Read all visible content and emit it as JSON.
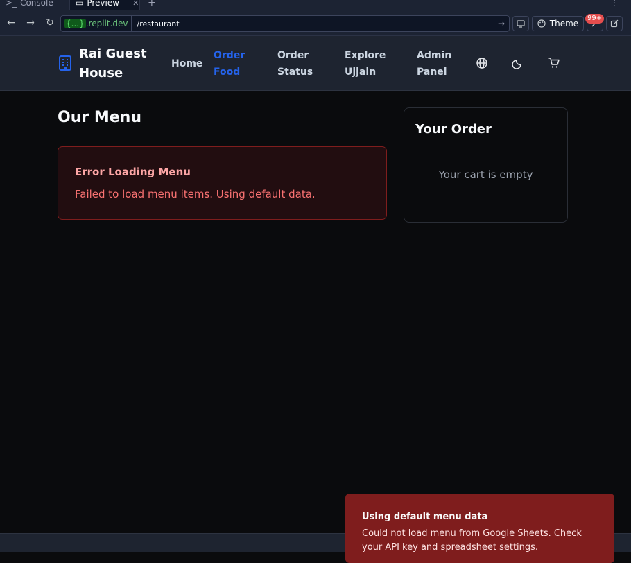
{
  "ide_tabs": {
    "console": "Console",
    "preview": "Preview"
  },
  "browser": {
    "domain_highlight": "{...}",
    "domain_rest": ".replit.dev",
    "path": "/restaurant",
    "theme_label": "Theme",
    "badge": "99+"
  },
  "site": {
    "brand": "Rai Guest House",
    "nav": [
      "Home",
      "Order Food",
      "Order Status",
      "Explore Ujjain",
      "Admin Panel"
    ],
    "active_nav": "Order Food"
  },
  "menu": {
    "title": "Our Menu",
    "error_title": "Error Loading Menu",
    "error_message": "Failed to load menu items. Using default data."
  },
  "order": {
    "title": "Your Order",
    "empty_text": "Your cart is empty"
  },
  "toast": {
    "title": "Using default menu data",
    "message": "Could not load menu from Google Sheets. Check your API key and spreadsheet settings."
  },
  "colors": {
    "accent": "#2563eb",
    "error_bg": "#220d10",
    "error_text": "#f87171",
    "toast_bg": "#7f1d1d"
  }
}
